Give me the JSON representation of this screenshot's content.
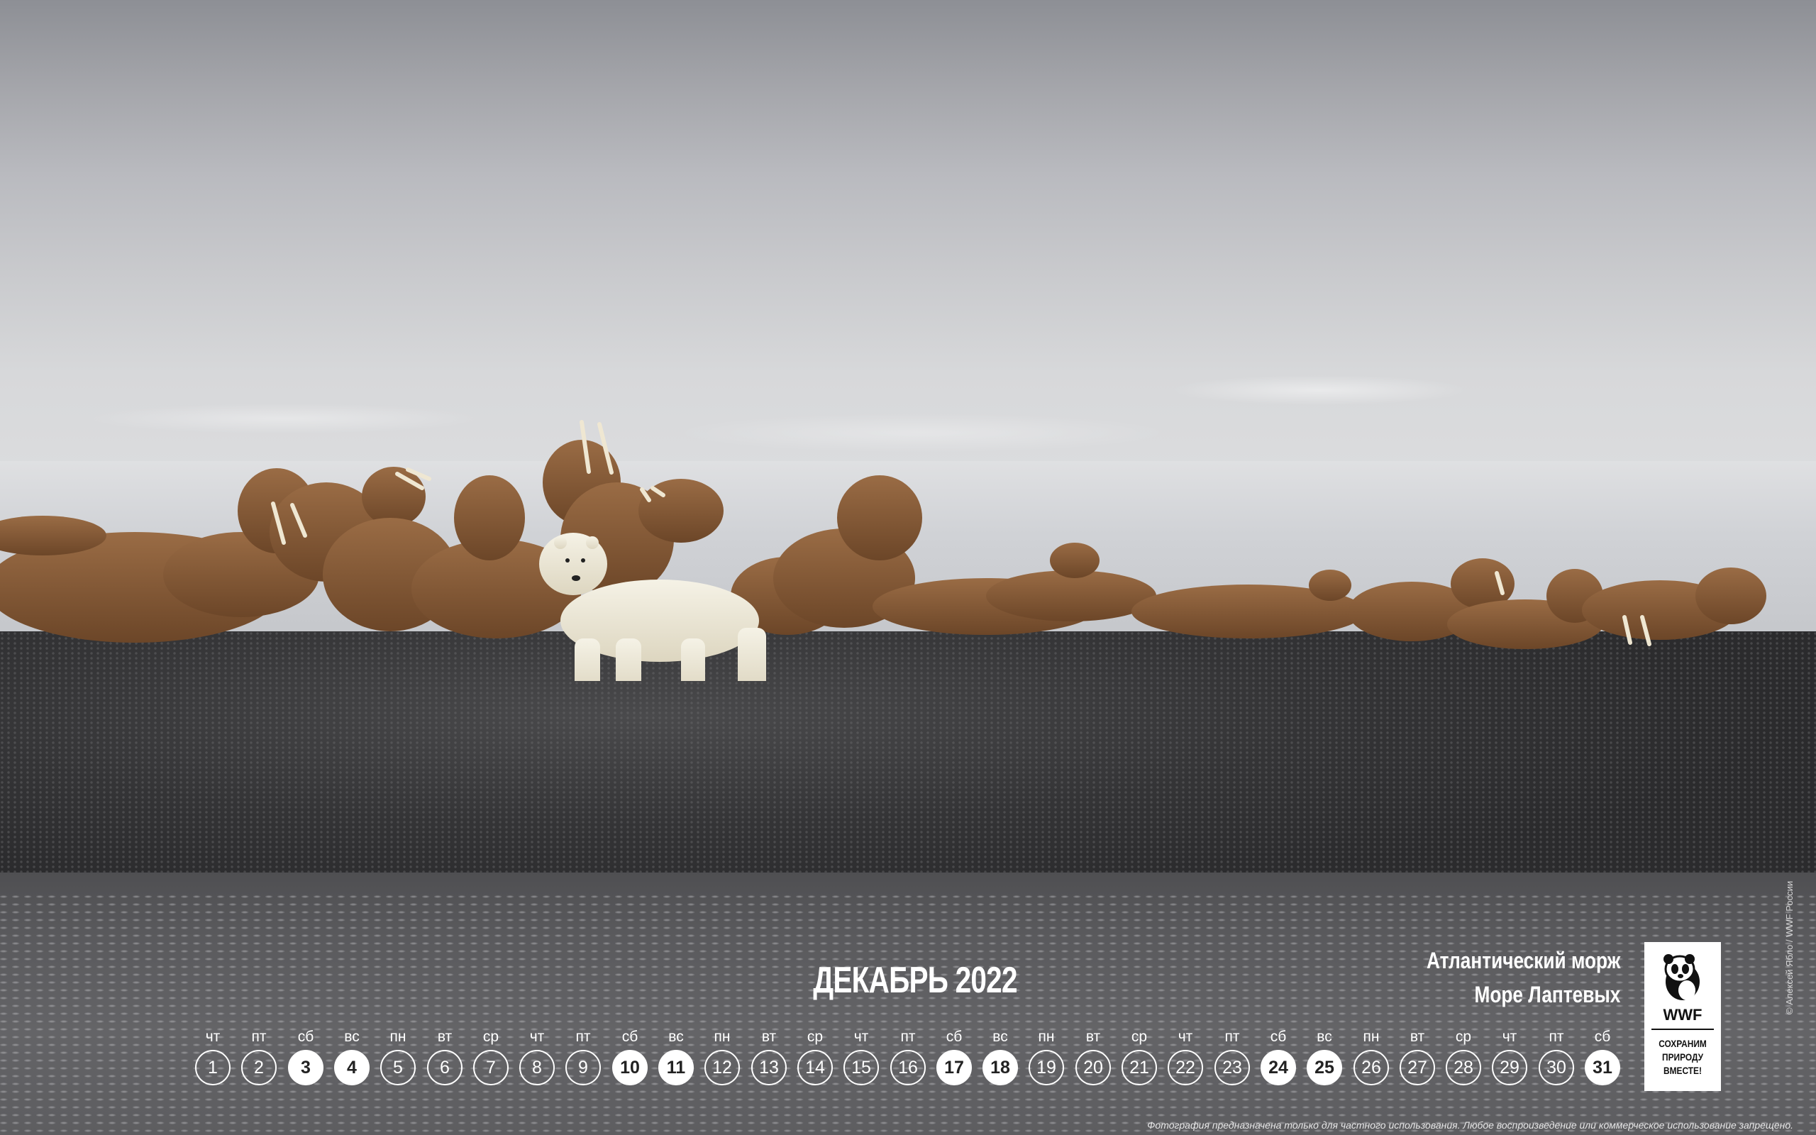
{
  "calendar": {
    "title": "ДЕКАБРЬ 2022",
    "days": [
      {
        "wd": "чт",
        "n": "1",
        "weekend": false
      },
      {
        "wd": "пт",
        "n": "2",
        "weekend": false
      },
      {
        "wd": "сб",
        "n": "3",
        "weekend": true
      },
      {
        "wd": "вс",
        "n": "4",
        "weekend": true
      },
      {
        "wd": "пн",
        "n": "5",
        "weekend": false
      },
      {
        "wd": "вт",
        "n": "6",
        "weekend": false
      },
      {
        "wd": "ср",
        "n": "7",
        "weekend": false
      },
      {
        "wd": "чт",
        "n": "8",
        "weekend": false
      },
      {
        "wd": "пт",
        "n": "9",
        "weekend": false
      },
      {
        "wd": "сб",
        "n": "10",
        "weekend": true
      },
      {
        "wd": "вс",
        "n": "11",
        "weekend": true
      },
      {
        "wd": "пн",
        "n": "12",
        "weekend": false
      },
      {
        "wd": "вт",
        "n": "13",
        "weekend": false
      },
      {
        "wd": "ср",
        "n": "14",
        "weekend": false
      },
      {
        "wd": "чт",
        "n": "15",
        "weekend": false
      },
      {
        "wd": "пт",
        "n": "16",
        "weekend": false
      },
      {
        "wd": "сб",
        "n": "17",
        "weekend": true
      },
      {
        "wd": "вс",
        "n": "18",
        "weekend": true
      },
      {
        "wd": "пн",
        "n": "19",
        "weekend": false
      },
      {
        "wd": "вт",
        "n": "20",
        "weekend": false
      },
      {
        "wd": "ср",
        "n": "21",
        "weekend": false
      },
      {
        "wd": "чт",
        "n": "22",
        "weekend": false
      },
      {
        "wd": "пт",
        "n": "23",
        "weekend": false
      },
      {
        "wd": "сб",
        "n": "24",
        "weekend": true
      },
      {
        "wd": "вс",
        "n": "25",
        "weekend": true
      },
      {
        "wd": "пн",
        "n": "26",
        "weekend": false
      },
      {
        "wd": "вт",
        "n": "27",
        "weekend": false
      },
      {
        "wd": "ср",
        "n": "28",
        "weekend": false
      },
      {
        "wd": "чт",
        "n": "29",
        "weekend": false
      },
      {
        "wd": "пт",
        "n": "30",
        "weekend": false
      },
      {
        "wd": "сб",
        "n": "31",
        "weekend": true
      }
    ]
  },
  "caption": {
    "species": "Атлантический морж",
    "location": "Море Лаптевых"
  },
  "logo": {
    "brand": "WWF",
    "slogan_1": "СОХРАНИМ",
    "slogan_2": "ПРИРОДУ",
    "slogan_3": "ВМЕСТЕ!"
  },
  "credit": "© Алексей Ябло / WWF России",
  "disclaimer": "Фотография предназначена только для частного использования. Любое воспроизведение или коммерческое использование запрещено.",
  "colors": {
    "text": "#ffffff",
    "walrus": "#8a5f3b",
    "bear": "#eeeadb"
  }
}
